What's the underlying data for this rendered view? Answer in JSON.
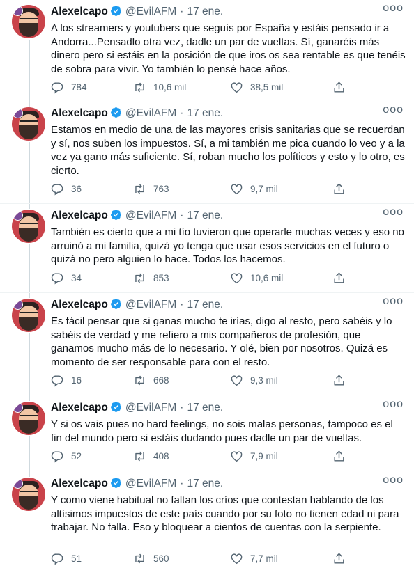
{
  "author": {
    "name": "Alexelcapo",
    "handle": "@EvilAFM",
    "date": "17 ene.",
    "more_label": "ooo"
  },
  "tweets": [
    {
      "text": "A los streamers y youtubers que seguís por España y estáis pensado ir a Andorra...Pensadlo otra vez, dadle un par de vueltas. Sí, ganaréis más dinero pero si estáis en la posición de que iros os sea rentable es que tenéis de sobra para vivir. Yo también lo pensé hace años.",
      "replies": "784",
      "retweets": "10,6 mil",
      "likes": "38,5 mil"
    },
    {
      "text": "Estamos en medio de una de las mayores crisis sanitarias que se recuerdan y sí, nos suben los impuestos. Sí, a mi también me pica cuando lo veo y a la vez ya gano más suficiente. Sí, roban mucho los políticos y esto y lo otro, es cierto.",
      "replies": "36",
      "retweets": "763",
      "likes": "9,7 mil"
    },
    {
      "text": "También es cierto que a mi tío tuvieron que operarle muchas veces y eso no arruinó a mi familia, quizá yo tenga que usar esos servicios en el futuro o quizá no pero alguien lo hace. Todos los hacemos.",
      "replies": "34",
      "retweets": "853",
      "likes": "10,6 mil"
    },
    {
      "text": "Es fácil pensar que si ganas mucho te irías, digo al resto, pero sabéis y lo sabéis de verdad y me refiero a mis compañeros de profesión, que ganamos mucho más de lo necesario. Y olé, bien por nosotros. Quizá es momento de ser responsable para con el resto.",
      "replies": "16",
      "retweets": "668",
      "likes": "9,3 mil"
    },
    {
      "text": "Y si os vais pues no hard feelings, no sois malas personas, tampoco es el fin del mundo pero si estáis dudando pues dadle un par de vueltas.",
      "replies": "52",
      "retweets": "408",
      "likes": "7,9 mil"
    },
    {
      "text": "Y como viene habitual no faltan los críos que contestan hablando de los altísimos impuestos de este país cuando por su foto no tienen edad ni para trabajar. No falla. Eso y bloquear a cientos de cuentas con la serpiente.",
      "replies": "51",
      "retweets": "560",
      "likes": "7,7 mil"
    }
  ],
  "colors": {
    "text": "#0f1419",
    "secondary": "#536471",
    "verified": "#1d9bf0",
    "thread_line": "#cfd9de"
  },
  "icons": [
    "reply-icon",
    "retweet-icon",
    "like-icon",
    "share-icon",
    "verified-icon",
    "more-icon"
  ]
}
